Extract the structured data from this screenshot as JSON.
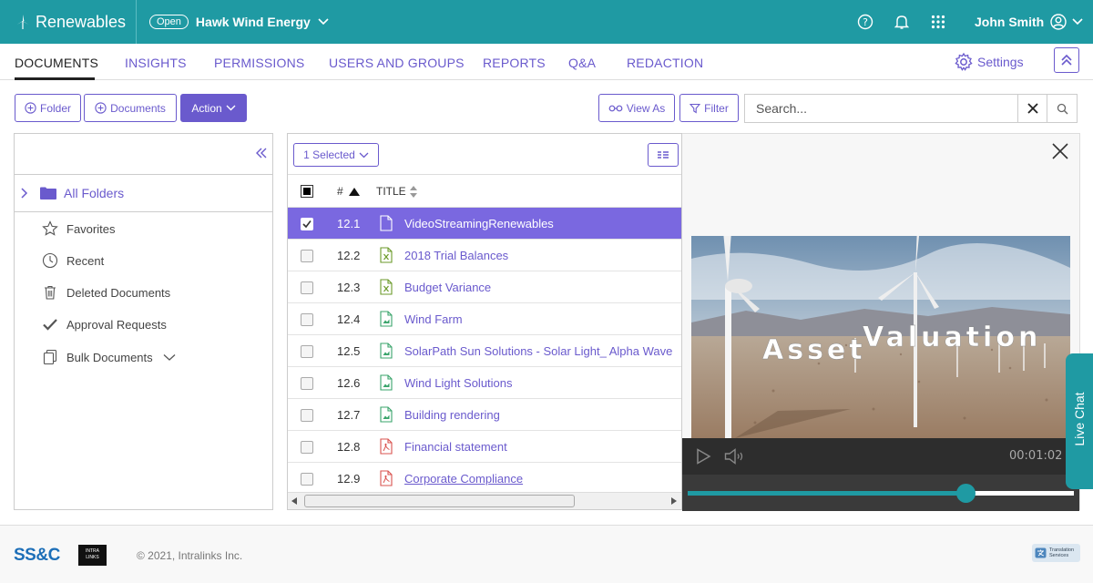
{
  "topbar": {
    "brand": "Renewables",
    "workspace_status": "Open",
    "workspace_name": "Hawk Wind Energy",
    "user_name": "John Smith",
    "color": "#1f9aa3"
  },
  "nav": {
    "tabs": [
      {
        "label": "DOCUMENTS",
        "active": true
      },
      {
        "label": "INSIGHTS"
      },
      {
        "label": "PERMISSIONS"
      },
      {
        "label": "USERS AND GROUPS"
      },
      {
        "label": "REPORTS"
      },
      {
        "label": "Q&A"
      },
      {
        "label": "REDACTION"
      }
    ],
    "settings_label": "Settings",
    "accent": "#6a5acd"
  },
  "toolbar": {
    "folder_label": "Folder",
    "documents_label": "Documents",
    "action_label": "Action",
    "view_as_label": "View As",
    "filter_label": "Filter",
    "search_placeholder": "Search..."
  },
  "left_panel": {
    "all_folders": "All Folders",
    "items": [
      {
        "label": "Favorites",
        "icon": "star-icon"
      },
      {
        "label": "Recent",
        "icon": "clock-icon"
      },
      {
        "label": "Deleted Documents",
        "icon": "trash-icon"
      },
      {
        "label": "Approval Requests",
        "icon": "check-icon"
      },
      {
        "label": "Bulk Documents",
        "icon": "documents-icon"
      }
    ]
  },
  "documents": {
    "selected_label": "1 Selected",
    "col_number": "#",
    "col_title": "TITLE",
    "rows": [
      {
        "num": "12.1",
        "title": "VideoStreamingRenewables",
        "type": "video",
        "selected": true
      },
      {
        "num": "12.2",
        "title": "2018 Trial Balances",
        "type": "excel"
      },
      {
        "num": "12.3",
        "title": "Budget Variance",
        "type": "excel"
      },
      {
        "num": "12.4",
        "title": "Wind Farm",
        "type": "image"
      },
      {
        "num": "12.5",
        "title": "SolarPath Sun Solutions - Solar Light_ Alpha Wave",
        "type": "image"
      },
      {
        "num": "12.6",
        "title": "Wind Light Solutions",
        "type": "image"
      },
      {
        "num": "12.7",
        "title": "Building rendering",
        "type": "image"
      },
      {
        "num": "12.8",
        "title": "Financial statement",
        "type": "pdf"
      },
      {
        "num": "12.9",
        "title": "Corporate Compliance",
        "type": "pdf"
      }
    ]
  },
  "preview": {
    "overlay_word_1": "Asset",
    "overlay_word_2": "Valuation",
    "time": "00:01:02",
    "progress": 0.72
  },
  "live_chat": "Live Chat",
  "footer": {
    "logo": "SS&C",
    "intralinks": "INTRA LINKS",
    "copyright": "© 2021, Intralinks Inc.",
    "translation": "Translation Services"
  }
}
